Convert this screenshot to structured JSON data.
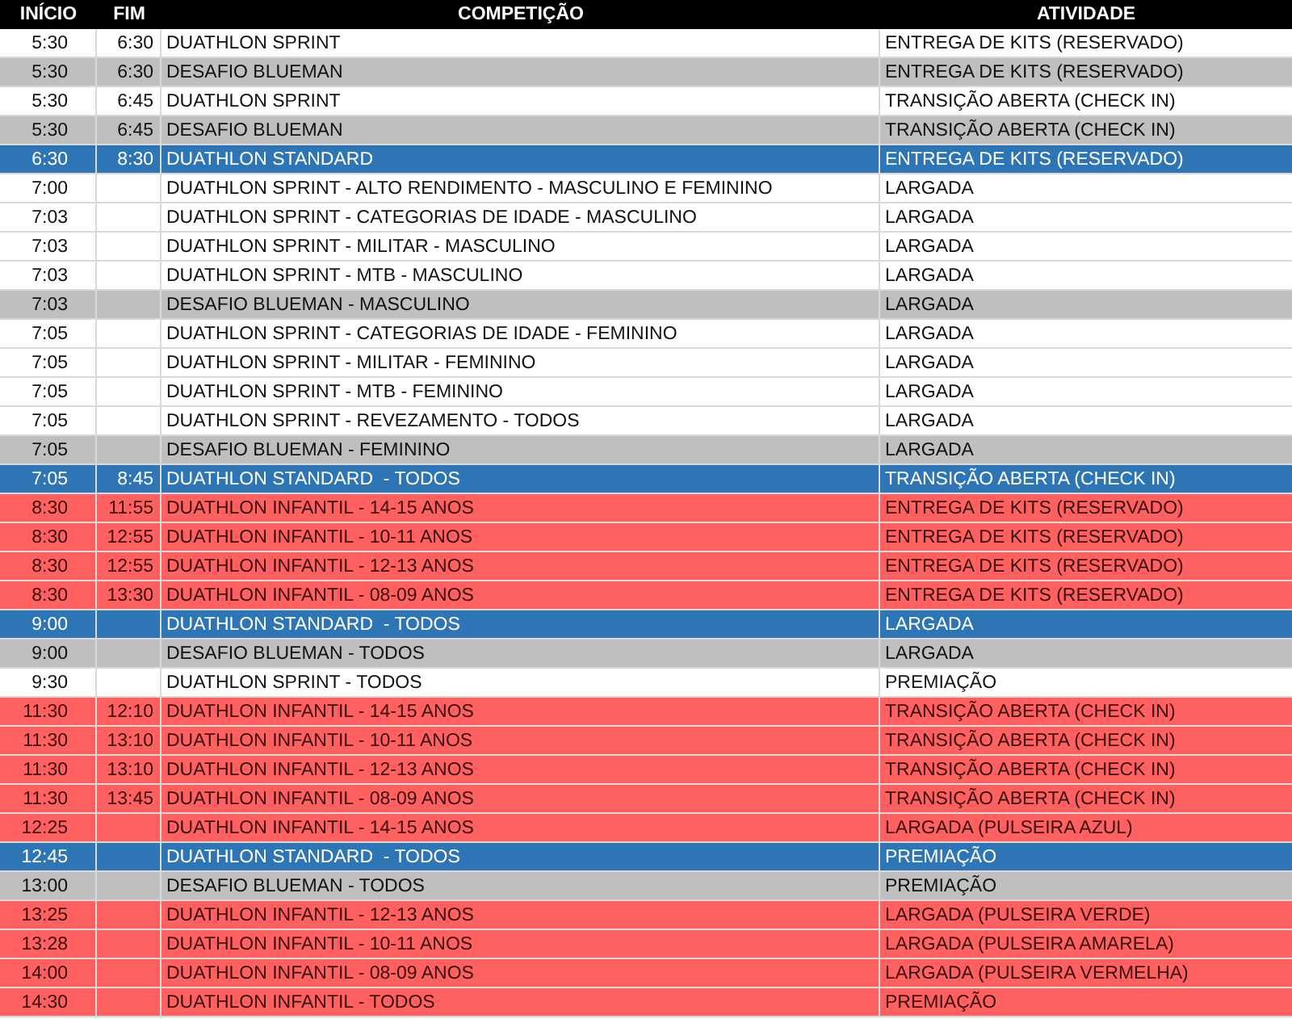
{
  "table": {
    "columns": [
      "INÍCIO",
      "FIM",
      "COMPETIÇÃO",
      "ATIVIDADE"
    ],
    "rows": [
      {
        "color": "#ffffff",
        "cells": [
          "5:30",
          "6:30",
          "DUATHLON SPRINT",
          "ENTREGA DE KITS (RESERVADO)"
        ]
      },
      {
        "color": "#bfbfbf",
        "cells": [
          "5:30",
          "6:30",
          "DESAFIO BLUEMAN",
          "ENTREGA DE KITS (RESERVADO)"
        ]
      },
      {
        "color": "#ffffff",
        "cells": [
          "5:30",
          "6:45",
          "DUATHLON SPRINT",
          "TRANSIÇÃO ABERTA (CHECK IN)"
        ]
      },
      {
        "color": "#bfbfbf",
        "cells": [
          "5:30",
          "6:45",
          "DESAFIO BLUEMAN",
          "TRANSIÇÃO ABERTA (CHECK IN)"
        ]
      },
      {
        "color": "#2e75b6",
        "cells": [
          "6:30",
          "8:30",
          "DUATHLON STANDARD",
          "ENTREGA DE KITS (RESERVADO)"
        ]
      },
      {
        "color": "#ffffff",
        "cells": [
          "7:00",
          "",
          "DUATHLON SPRINT - ALTO RENDIMENTO - MASCULINO E FEMININO",
          "LARGADA"
        ]
      },
      {
        "color": "#ffffff",
        "cells": [
          "7:03",
          "",
          "DUATHLON SPRINT - CATEGORIAS DE IDADE - MASCULINO",
          "LARGADA"
        ]
      },
      {
        "color": "#ffffff",
        "cells": [
          "7:03",
          "",
          "DUATHLON SPRINT - MILITAR - MASCULINO",
          "LARGADA"
        ]
      },
      {
        "color": "#ffffff",
        "cells": [
          "7:03",
          "",
          "DUATHLON SPRINT - MTB - MASCULINO",
          "LARGADA"
        ]
      },
      {
        "color": "#bfbfbf",
        "cells": [
          "7:03",
          "",
          "DESAFIO BLUEMAN - MASCULINO",
          "LARGADA"
        ]
      },
      {
        "color": "#ffffff",
        "cells": [
          "7:05",
          "",
          "DUATHLON SPRINT - CATEGORIAS DE IDADE - FEMININO",
          "LARGADA"
        ]
      },
      {
        "color": "#ffffff",
        "cells": [
          "7:05",
          "",
          "DUATHLON SPRINT - MILITAR - FEMININO",
          "LARGADA"
        ]
      },
      {
        "color": "#ffffff",
        "cells": [
          "7:05",
          "",
          "DUATHLON SPRINT - MTB - FEMININO",
          "LARGADA"
        ]
      },
      {
        "color": "#ffffff",
        "cells": [
          "7:05",
          "",
          "DUATHLON SPRINT - REVEZAMENTO - TODOS",
          "LARGADA"
        ]
      },
      {
        "color": "#bfbfbf",
        "cells": [
          "7:05",
          "",
          "DESAFIO BLUEMAN - FEMININO",
          "LARGADA"
        ]
      },
      {
        "color": "#2e75b6",
        "cells": [
          "7:05",
          "8:45",
          "DUATHLON STANDARD  - TODOS",
          "TRANSIÇÃO ABERTA (CHECK IN)"
        ]
      },
      {
        "color": "#ff6161",
        "cells": [
          "8:30",
          "11:55",
          "DUATHLON INFANTIL - 14-15 ANOS",
          "ENTREGA DE KITS (RESERVADO)"
        ]
      },
      {
        "color": "#ff6161",
        "cells": [
          "8:30",
          "12:55",
          "DUATHLON INFANTIL - 10-11 ANOS",
          "ENTREGA DE KITS (RESERVADO)"
        ]
      },
      {
        "color": "#ff6161",
        "cells": [
          "8:30",
          "12:55",
          "DUATHLON INFANTIL - 12-13 ANOS",
          "ENTREGA DE KITS (RESERVADO)"
        ]
      },
      {
        "color": "#ff6161",
        "cells": [
          "8:30",
          "13:30",
          "DUATHLON INFANTIL - 08-09 ANOS",
          "ENTREGA DE KITS (RESERVADO)"
        ]
      },
      {
        "color": "#2e75b6",
        "cells": [
          "9:00",
          "",
          "DUATHLON STANDARD  - TODOS",
          "LARGADA"
        ]
      },
      {
        "color": "#bfbfbf",
        "cells": [
          "9:00",
          "",
          "DESAFIO BLUEMAN - TODOS",
          "LARGADA"
        ]
      },
      {
        "color": "#ffffff",
        "cells": [
          "9:30",
          "",
          "DUATHLON SPRINT - TODOS",
          "PREMIAÇÃO"
        ]
      },
      {
        "color": "#ff6161",
        "cells": [
          "11:30",
          "12:10",
          "DUATHLON INFANTIL - 14-15 ANOS",
          "TRANSIÇÃO ABERTA (CHECK IN)"
        ]
      },
      {
        "color": "#ff6161",
        "cells": [
          "11:30",
          "13:10",
          "DUATHLON INFANTIL - 10-11 ANOS",
          "TRANSIÇÃO ABERTA (CHECK IN)"
        ]
      },
      {
        "color": "#ff6161",
        "cells": [
          "11:30",
          "13:10",
          "DUATHLON INFANTIL - 12-13 ANOS",
          "TRANSIÇÃO ABERTA (CHECK IN)"
        ]
      },
      {
        "color": "#ff6161",
        "cells": [
          "11:30",
          "13:45",
          "DUATHLON INFANTIL - 08-09 ANOS",
          "TRANSIÇÃO ABERTA (CHECK IN)"
        ]
      },
      {
        "color": "#ff6161",
        "cells": [
          "12:25",
          "",
          "DUATHLON INFANTIL - 14-15 ANOS",
          "LARGADA (PULSEIRA AZUL)"
        ]
      },
      {
        "color": "#2e75b6",
        "cells": [
          "12:45",
          "",
          "DUATHLON STANDARD  - TODOS",
          "PREMIAÇÃO"
        ]
      },
      {
        "color": "#bfbfbf",
        "cells": [
          "13:00",
          "",
          "DESAFIO BLUEMAN - TODOS",
          "PREMIAÇÃO"
        ]
      },
      {
        "color": "#ff6161",
        "cells": [
          "13:25",
          "",
          "DUATHLON INFANTIL - 12-13 ANOS",
          "LARGADA (PULSEIRA VERDE)"
        ]
      },
      {
        "color": "#ff6161",
        "cells": [
          "13:28",
          "",
          "DUATHLON INFANTIL - 10-11 ANOS",
          "LARGADA (PULSEIRA AMARELA)"
        ]
      },
      {
        "color": "#ff6161",
        "cells": [
          "14:00",
          "",
          "DUATHLON INFANTIL - 08-09 ANOS",
          "LARGADA (PULSEIRA VERMELHA)"
        ]
      },
      {
        "color": "#ff6161",
        "cells": [
          "14:30",
          "",
          "DUATHLON INFANTIL - TODOS",
          "PREMIAÇÃO"
        ]
      }
    ]
  }
}
